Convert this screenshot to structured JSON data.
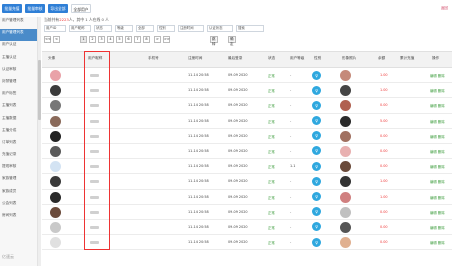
{
  "topbar": {
    "buttons": [
      "批量充值",
      "批量审核",
      "导出全部"
    ],
    "tab": "全部用户",
    "right_text": "返回"
  },
  "sidebar": {
    "items": [
      "用户管理列表",
      "用户管理列表",
      "用户认证",
      "主播认证",
      "认证审核",
      "封禁管理",
      "用户标签",
      "主播列表",
      "主播数据",
      "主播分成",
      "订单列表",
      "充值记录",
      "提现审核",
      "家族管理",
      "家族成员",
      "公会列表",
      "房间列表"
    ]
  },
  "notice": {
    "prefix": "当前共有",
    "count": "2223",
    "suffix": "人，其中 1 人在线 0 人"
  },
  "filters": {
    "f1": "用户ID",
    "f2": "用户昵称",
    "f3": "状态",
    "f4": "等级",
    "f5": "全部",
    "f6": "性别",
    "f7": "注册时间",
    "f8": "认证状态",
    "f9": "搜索"
  },
  "pager": {
    "pages": [
      "1",
      "2",
      "3",
      "4",
      "5",
      "6",
      "7",
      "8"
    ],
    "first": "<<",
    "prev": "<",
    "next": ">",
    "last": ">>",
    "go": "跳转",
    "confirm": "确定"
  },
  "table": {
    "headers": [
      "头像",
      "用户昵称",
      "手机号",
      "注册时间",
      "最后登录",
      "状态",
      "用户等级",
      "性别",
      "形象照片",
      "余额",
      "累计充值",
      "操作"
    ],
    "rows": [
      {
        "avatar_color": "#e9a2a8",
        "reg": "11-14 20:58",
        "last": "09-09 2020",
        "status": "正常",
        "level": "-",
        "balance": "1.00",
        "op": "编辑 删除"
      },
      {
        "avatar_color": "#3b3b3b",
        "reg": "11-14 20:58",
        "last": "09-09 2020",
        "status": "正常",
        "level": "-",
        "balance": "1.00",
        "op": "编辑 删除"
      },
      {
        "avatar_color": "#777777",
        "reg": "11-14 20:58",
        "last": "09-09 2020",
        "status": "正常",
        "level": "-",
        "balance": "0.00",
        "op": "编辑 删除"
      },
      {
        "avatar_color": "#8a6a5a",
        "reg": "11-14 20:58",
        "last": "09-09 2020",
        "status": "正常",
        "level": "-",
        "balance": "5.00",
        "op": "编辑 删除"
      },
      {
        "avatar_color": "#222222",
        "reg": "11-14 20:58",
        "last": "09-09 2020",
        "status": "正常",
        "level": "-",
        "balance": "0.00",
        "op": "编辑 删除"
      },
      {
        "avatar_color": "#5a5a5a",
        "reg": "11-14 20:58",
        "last": "09-09 2020",
        "status": "正常",
        "level": "-",
        "balance": "0.00",
        "op": "编辑 删除"
      },
      {
        "avatar_color": "#d3e3f3",
        "reg": "11-14 20:58",
        "last": "09-09 2020",
        "status": "正常",
        "level": "1.1",
        "balance": "0.00",
        "op": "编辑 删除"
      },
      {
        "avatar_color": "#3a3a3a",
        "reg": "11-14 20:58",
        "last": "09-09 2020",
        "status": "正常",
        "level": "-",
        "balance": "1.00",
        "op": "编辑 删除"
      },
      {
        "avatar_color": "#2a2a2a",
        "reg": "11-14 20:58",
        "last": "09-09 2020",
        "status": "正常",
        "level": "-",
        "balance": "1.00",
        "op": "编辑 删除"
      },
      {
        "avatar_color": "#6b4b3b",
        "reg": "11-14 20:58",
        "last": "09-09 2020",
        "status": "正常",
        "level": "-",
        "balance": "0.00",
        "op": "编辑 删除"
      },
      {
        "avatar_color": "#c9c9c9",
        "reg": "11-14 20:58",
        "last": "09-09 2020",
        "status": "正常",
        "level": "-",
        "balance": "0.00",
        "op": "编辑 删除"
      },
      {
        "avatar_color": "#e0e0e0",
        "reg": "11-14 20:58",
        "last": "09-09 2020",
        "status": "正常",
        "level": "-",
        "balance": "0.00",
        "op": "编辑 删除"
      }
    ]
  },
  "watermark": "亿速云"
}
